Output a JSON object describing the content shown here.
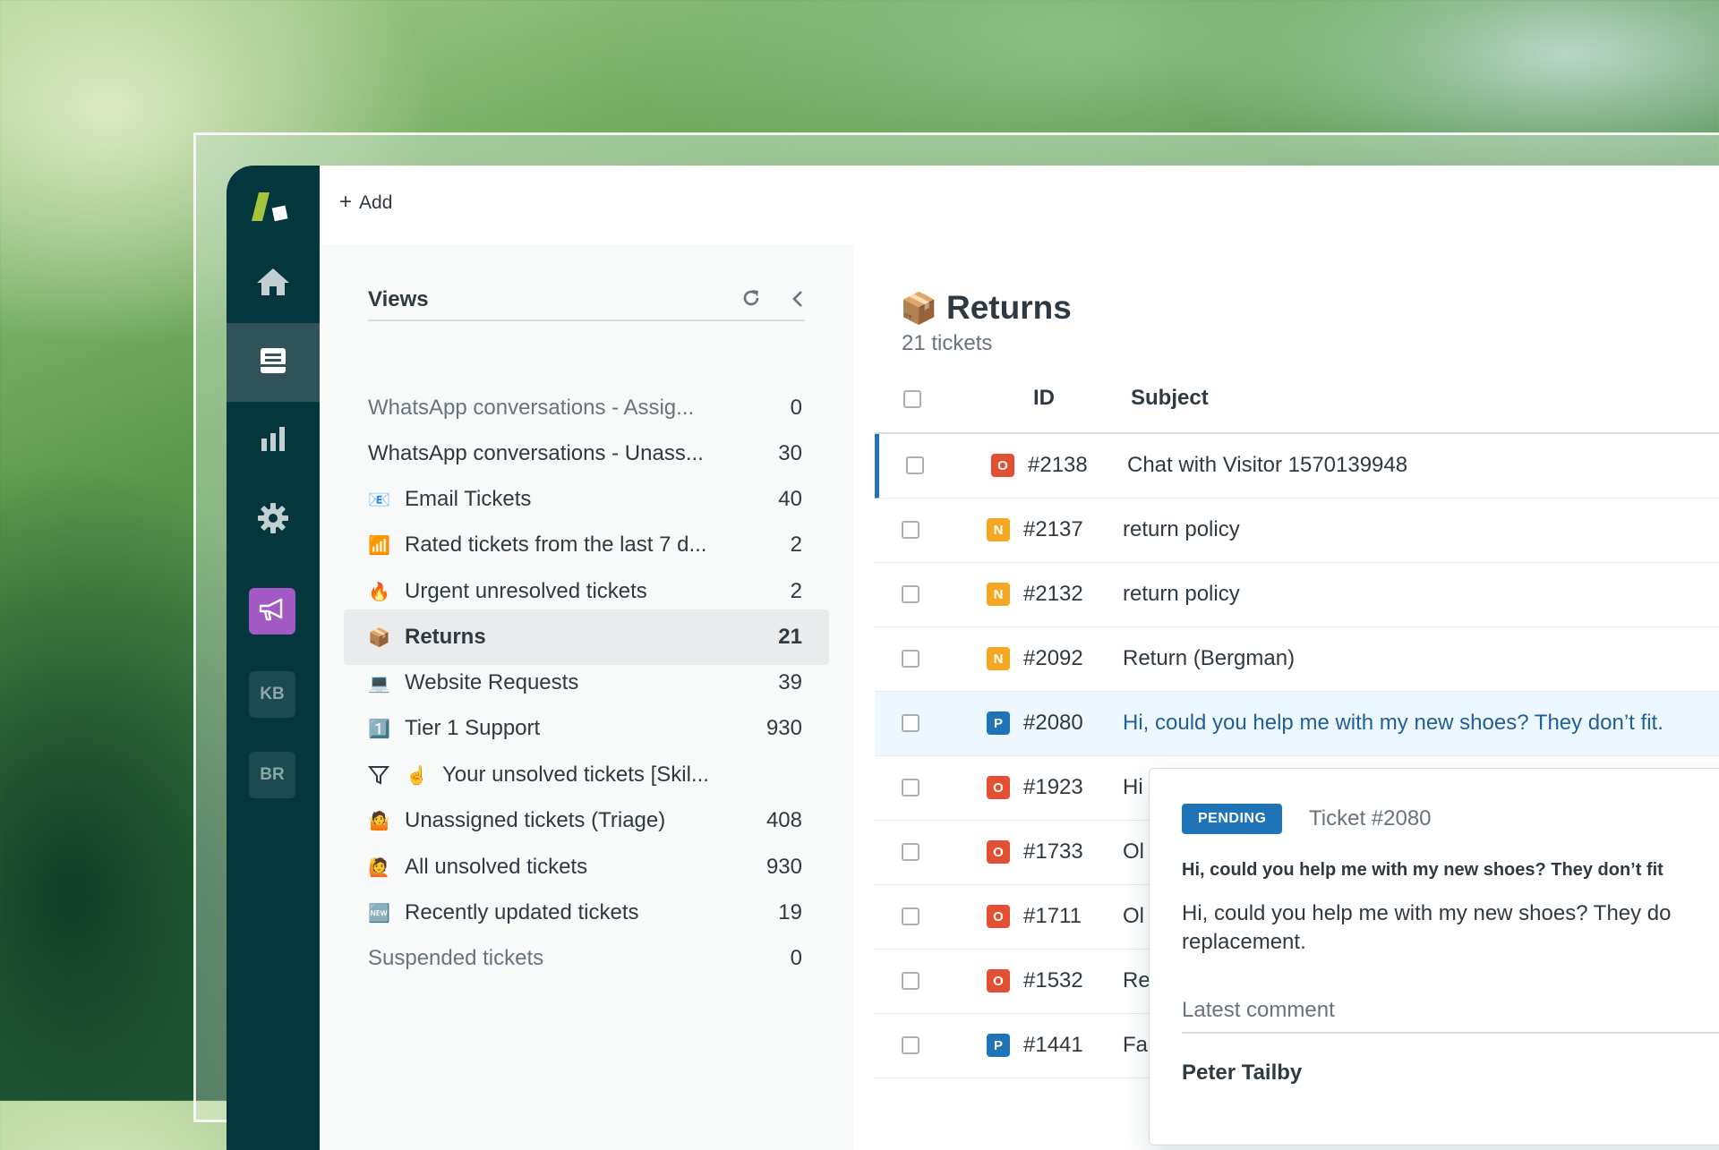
{
  "topbar": {
    "add_label": "Add"
  },
  "rail": {
    "badges": [
      "KB",
      "BR"
    ]
  },
  "views": {
    "title": "Views",
    "items": [
      {
        "icon": "",
        "name": "WhatsApp conversations - Assig...",
        "count": "0",
        "muted": true
      },
      {
        "icon": "",
        "name": "WhatsApp conversations - Unass...",
        "count": "30"
      },
      {
        "icon": "📧",
        "name": "Email Tickets",
        "count": "40"
      },
      {
        "icon": "📶",
        "name": "Rated tickets from the last 7 d...",
        "count": "2"
      },
      {
        "icon": "🔥",
        "name": "Urgent unresolved tickets",
        "count": "2"
      },
      {
        "icon": "📦",
        "name": "Returns",
        "count": "21",
        "active": true
      },
      {
        "icon": "💻",
        "name": "Website Requests",
        "count": "39"
      },
      {
        "icon": "1️⃣",
        "name": "Tier 1 Support",
        "count": "930"
      },
      {
        "icon": "☝️",
        "name": "Your unsolved tickets [Skil...",
        "count": ""
      },
      {
        "icon": "🤷",
        "name": "Unassigned tickets (Triage)",
        "count": "408"
      },
      {
        "icon": "🙋",
        "name": "All unsolved tickets",
        "count": "930"
      },
      {
        "icon": "🆕",
        "name": "Recently updated tickets",
        "count": "19"
      },
      {
        "icon": "",
        "name": "Suspended tickets",
        "count": "0",
        "muted": true
      }
    ]
  },
  "tickets": {
    "icon": "📦",
    "title": "Returns",
    "subtitle": "21 tickets",
    "columns": {
      "id": "ID",
      "subject": "Subject"
    },
    "rows": [
      {
        "status": "O",
        "id": "#2138",
        "subject": "Chat with Visitor 1570139948"
      },
      {
        "status": "N",
        "id": "#2137",
        "subject": "return policy"
      },
      {
        "status": "N",
        "id": "#2132",
        "subject": "return policy"
      },
      {
        "status": "N",
        "id": "#2092",
        "subject": "Return (Bergman)"
      },
      {
        "status": "P",
        "id": "#2080",
        "subject": "Hi, could you help me with my new shoes? They don’t fit."
      },
      {
        "status": "O",
        "id": "#1923",
        "subject": "Hi"
      },
      {
        "status": "O",
        "id": "#1733",
        "subject": "Ol"
      },
      {
        "status": "O",
        "id": "#1711",
        "subject": "Ol"
      },
      {
        "status": "O",
        "id": "#1532",
        "subject": "Re"
      },
      {
        "status": "P",
        "id": "#1441",
        "subject": "Fa"
      }
    ]
  },
  "popover": {
    "status": "PENDING",
    "ticket": "Ticket #2080",
    "subject": "Hi, could you help me with my new shoes? They don’t fit",
    "body": "Hi, could you help me with my new shoes? They do replacement.",
    "latest_label": "Latest comment",
    "author": "Peter Tailby"
  },
  "colors": {
    "rail": "#03363d",
    "accent": "#1f73b7",
    "status_open": "#e34f32",
    "status_new": "#f5a623",
    "status_pending": "#1f73b7",
    "megaphone": "#a259c4"
  }
}
